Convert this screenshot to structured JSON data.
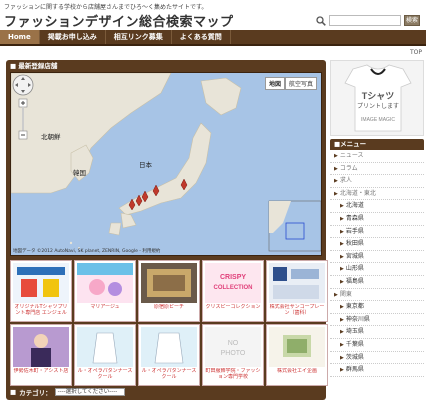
{
  "header": {
    "tagline": "ファッションに関する学校から店舗屋さんまでひろ～く集めたサイトです。",
    "title": "ファッションデザイン総合検索マップ",
    "search_button": "検索"
  },
  "nav": {
    "items": [
      {
        "label": "Home",
        "active": true
      },
      {
        "label": "掲載お申し込み",
        "active": false
      },
      {
        "label": "相互リンク募集",
        "active": false
      },
      {
        "label": "よくある質問",
        "active": false
      }
    ],
    "top_link": "TOP"
  },
  "main": {
    "panel_title": "最新登録店舗",
    "map": {
      "tab_map": "地図",
      "tab_satellite": "航空写真",
      "labels": {
        "hokkaido": "北朝鮮",
        "korea": "韓国",
        "japan": "日本"
      },
      "credits": "地図データ ©2012 AutoNavi, SK planet, ZENRIN, Google - 利用規約"
    },
    "cards": [
      {
        "label": "オリジナルTシャツプリント専門店 エンジェル"
      },
      {
        "label": "マリアージュ"
      },
      {
        "label": "原宿原ピーチ"
      },
      {
        "label": "クリスピーコレクション"
      },
      {
        "label": "株式会社サンコープレーン（歯科）"
      },
      {
        "label": "伊勢佐木町・アシスト店"
      },
      {
        "label": "ル・オペラパタンナースクール"
      },
      {
        "label": "ル・オペラパタンナースクール"
      },
      {
        "label": "町田服飾学院・ファッション専門学校"
      },
      {
        "label": "株式会社エイ企画"
      }
    ],
    "category_label": "カテゴリ：",
    "category_select": "----選択してください----"
  },
  "sidebar": {
    "ad": {
      "line1": "Tシャツ",
      "line2": "プリントします",
      "brand": "IMAGE MAGIC"
    },
    "menu_title": "メニュー",
    "items": [
      {
        "label": "ニュース",
        "sub": false
      },
      {
        "label": "コラム",
        "sub": false
      },
      {
        "label": "求人",
        "sub": false
      },
      {
        "label": "北海道・東北",
        "sub": false
      },
      {
        "label": "北海道",
        "sub": true
      },
      {
        "label": "青森県",
        "sub": true
      },
      {
        "label": "岩手県",
        "sub": true
      },
      {
        "label": "秋田県",
        "sub": true
      },
      {
        "label": "宮城県",
        "sub": true
      },
      {
        "label": "山形県",
        "sub": true
      },
      {
        "label": "福島県",
        "sub": true
      },
      {
        "label": "関東",
        "sub": false
      },
      {
        "label": "東京都",
        "sub": true
      },
      {
        "label": "神奈川県",
        "sub": true
      },
      {
        "label": "埼玉県",
        "sub": true
      },
      {
        "label": "千葉県",
        "sub": true
      },
      {
        "label": "茨城県",
        "sub": true
      },
      {
        "label": "群馬県",
        "sub": true
      }
    ]
  }
}
